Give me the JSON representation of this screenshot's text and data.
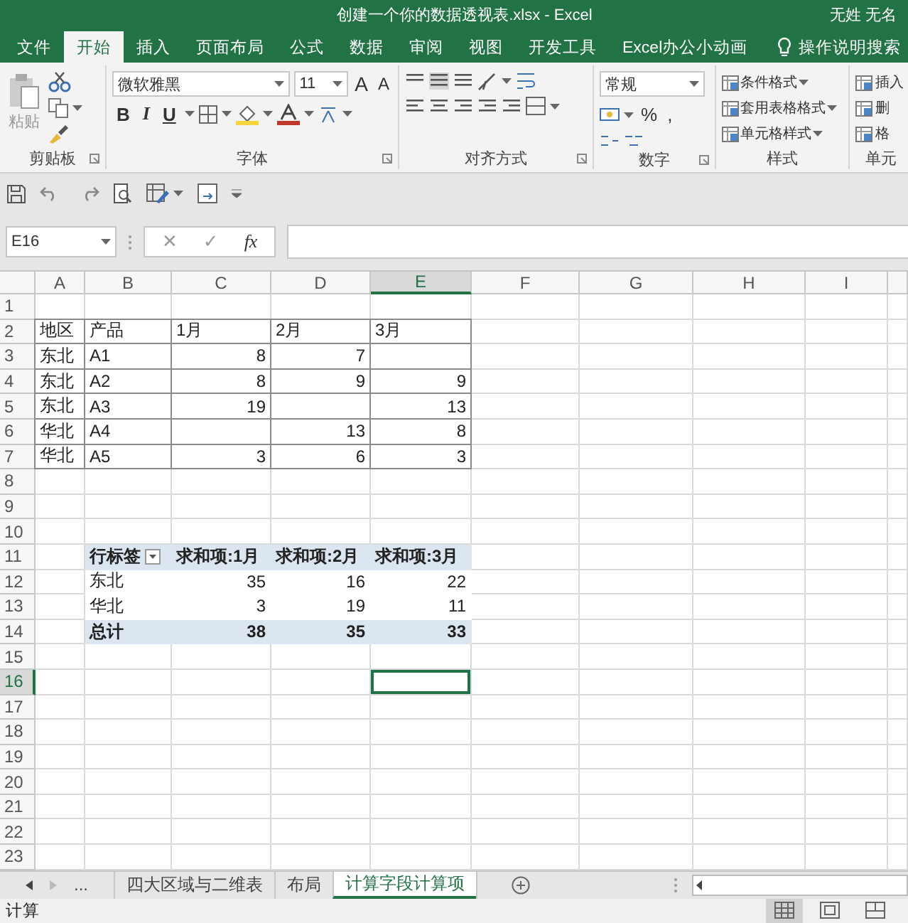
{
  "window": {
    "title": "创建一个你的数据透视表.xlsx  -  Excel",
    "user": "无姓 无名"
  },
  "ribbon_tabs": [
    {
      "label": "文件",
      "selected": false
    },
    {
      "label": "开始",
      "selected": true
    },
    {
      "label": "插入",
      "selected": false
    },
    {
      "label": "页面布局",
      "selected": false
    },
    {
      "label": "公式",
      "selected": false
    },
    {
      "label": "数据",
      "selected": false
    },
    {
      "label": "审阅",
      "selected": false
    },
    {
      "label": "视图",
      "selected": false
    },
    {
      "label": "开发工具",
      "selected": false
    },
    {
      "label": "Excel办公小动画",
      "selected": false
    }
  ],
  "tell_me": "操作说明搜索",
  "ribbon": {
    "clipboard": {
      "paste": "粘贴",
      "label": "剪贴板"
    },
    "font": {
      "name": "微软雅黑",
      "size": "11",
      "size_buttons": [
        "A",
        "A"
      ],
      "format_buttons": [
        "B",
        "I",
        "U"
      ],
      "label": "字体"
    },
    "alignment": {
      "label": "对齐方式"
    },
    "number": {
      "format": "常规",
      "buttons": [
        "%",
        ","
      ],
      "label": "数字"
    },
    "styles": {
      "buttons": [
        "条件格式",
        "套用表格格式",
        "单元格样式"
      ],
      "label": "样式"
    },
    "cells": {
      "buttons": [
        "插入",
        "删",
        "格"
      ],
      "label": "单元"
    }
  },
  "name_box": "E16",
  "formula_buttons": [
    "✕",
    "✓",
    "fx"
  ],
  "columns": [
    {
      "label": "A",
      "active": false
    },
    {
      "label": "B",
      "active": false
    },
    {
      "label": "C",
      "active": false
    },
    {
      "label": "D",
      "active": false
    },
    {
      "label": "E",
      "active": true
    },
    {
      "label": "F",
      "active": false
    },
    {
      "label": "G",
      "active": false
    },
    {
      "label": "H",
      "active": false
    },
    {
      "label": "I",
      "active": false
    }
  ],
  "rows": [
    {
      "label": "1",
      "active": false
    },
    {
      "label": "2",
      "active": false
    },
    {
      "label": "3",
      "active": false
    },
    {
      "label": "4",
      "active": false
    },
    {
      "label": "5",
      "active": false
    },
    {
      "label": "6",
      "active": false
    },
    {
      "label": "7",
      "active": false
    },
    {
      "label": "8",
      "active": false
    },
    {
      "label": "9",
      "active": false
    },
    {
      "label": "10",
      "active": false
    },
    {
      "label": "11",
      "active": false
    },
    {
      "label": "12",
      "active": false
    },
    {
      "label": "13",
      "active": false
    },
    {
      "label": "14",
      "active": false
    },
    {
      "label": "15",
      "active": false
    },
    {
      "label": "16",
      "active": true
    },
    {
      "label": "17",
      "active": false
    },
    {
      "label": "18",
      "active": false
    },
    {
      "label": "19",
      "active": false
    },
    {
      "label": "20",
      "active": false
    },
    {
      "label": "21",
      "active": false
    },
    {
      "label": "22",
      "active": false
    },
    {
      "label": "23",
      "active": false
    }
  ],
  "source_table": {
    "header": [
      "地区",
      "产品",
      "1月",
      "2月",
      "3月"
    ],
    "rows": [
      [
        "东北",
        "A1",
        "8",
        "7",
        null
      ],
      [
        "东北",
        "A2",
        "8",
        "9",
        "9"
      ],
      [
        "东北",
        "A3",
        "19",
        null,
        "13"
      ],
      [
        "华北",
        "A4",
        null,
        "13",
        "8"
      ],
      [
        "华北",
        "A5",
        "3",
        "6",
        "3"
      ]
    ]
  },
  "pivot_table": {
    "rows": [
      {
        "kind": "header",
        "cells": [
          "行标签",
          "求和项:1月",
          "求和项:2月",
          "求和项:3月"
        ]
      },
      {
        "kind": "item",
        "cells": [
          "东北",
          "35",
          "16",
          "22"
        ]
      },
      {
        "kind": "item",
        "cells": [
          "华北",
          "3",
          "19",
          "11"
        ]
      },
      {
        "kind": "total",
        "cells": [
          "总计",
          "38",
          "35",
          "33"
        ]
      }
    ]
  },
  "sheet_tabs": {
    "more": "...",
    "tabs": [
      {
        "label": "四大区域与二维表",
        "selected": false
      },
      {
        "label": "布局",
        "selected": false
      },
      {
        "label": "计算字段计算项",
        "selected": true
      }
    ]
  },
  "status_bar": {
    "mode": "计算",
    "views": [
      {
        "kind": "normal",
        "selected": true
      },
      {
        "kind": "page_layout",
        "selected": false
      },
      {
        "kind": "page_break",
        "selected": false
      }
    ]
  }
}
